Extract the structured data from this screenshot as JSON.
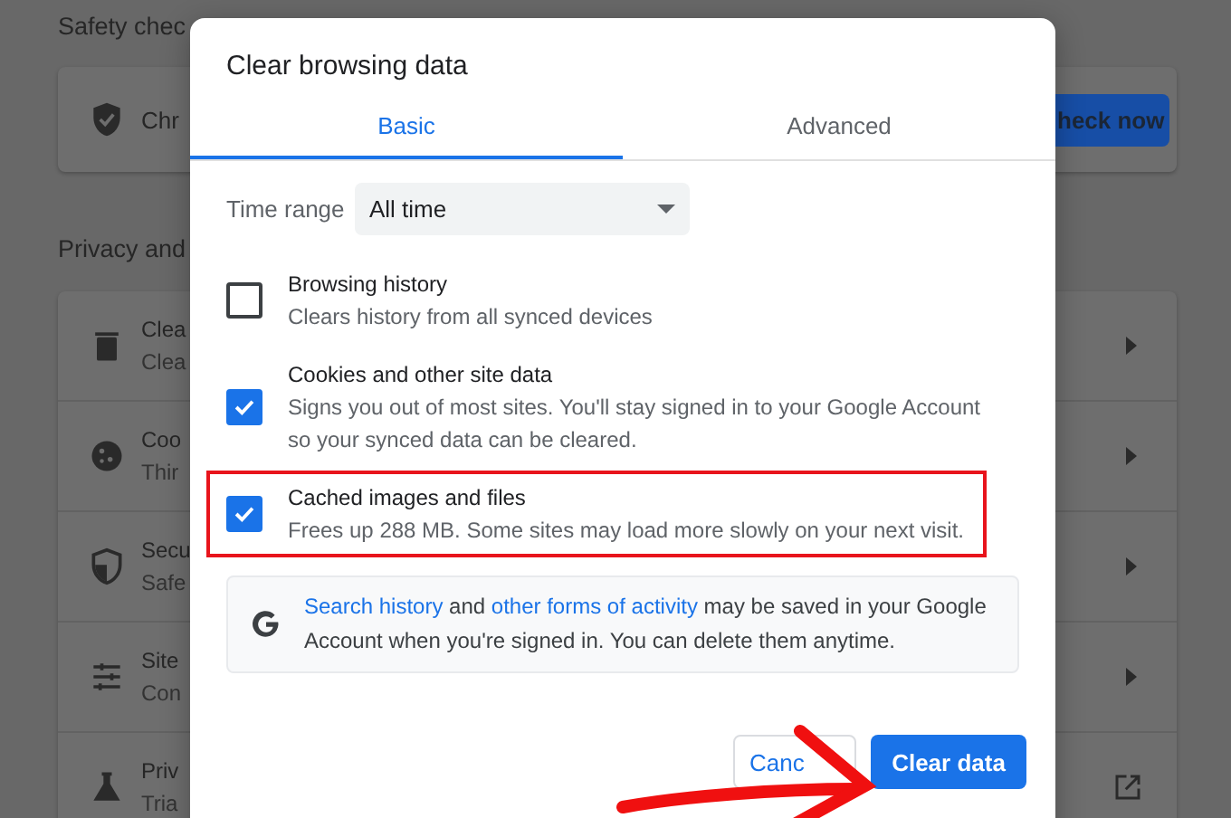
{
  "background": {
    "safety_heading": "Safety chec",
    "safety_row": {
      "title": "Chr",
      "button": "heck now"
    },
    "privacy_heading": "Privacy and",
    "privacy_rows": [
      {
        "kind": "trash",
        "title": "Clea",
        "subtitle": "Clea"
      },
      {
        "kind": "cookie",
        "title": "Coo",
        "subtitle": "Thir"
      },
      {
        "kind": "shield",
        "title": "Secu",
        "subtitle": "Safe"
      },
      {
        "kind": "sliders",
        "title": "Site",
        "subtitle": "Con"
      },
      {
        "kind": "flask",
        "title": "Priv",
        "subtitle": "Tria"
      }
    ]
  },
  "dialog": {
    "title": "Clear browsing data",
    "tabs": [
      {
        "label": "Basic",
        "selected": true
      },
      {
        "label": "Advanced",
        "selected": false
      }
    ],
    "time_range": {
      "label": "Time range",
      "value": "All time"
    },
    "options": [
      {
        "title": "Browsing history",
        "description": "Clears history from all synced devices",
        "checked": false,
        "highlighted": false
      },
      {
        "title": "Cookies and other site data",
        "description": "Signs you out of most sites. You'll stay signed in to your Google Account so your synced data can be cleared.",
        "checked": true,
        "highlighted": false
      },
      {
        "title": "Cached images and files",
        "description": "Frees up 288 MB. Some sites may load more slowly on your next visit.",
        "checked": true,
        "highlighted": true
      }
    ],
    "notice": {
      "link_1": "Search history",
      "text_1": " and ",
      "link_2": "other forms of activity",
      "text_2": " may be saved in your Google Account when you're signed in. You can delete them anytime."
    },
    "buttons": [
      {
        "label": "Canc",
        "kind": "secondary"
      },
      {
        "label": "Clear data",
        "kind": "primary"
      }
    ]
  }
}
